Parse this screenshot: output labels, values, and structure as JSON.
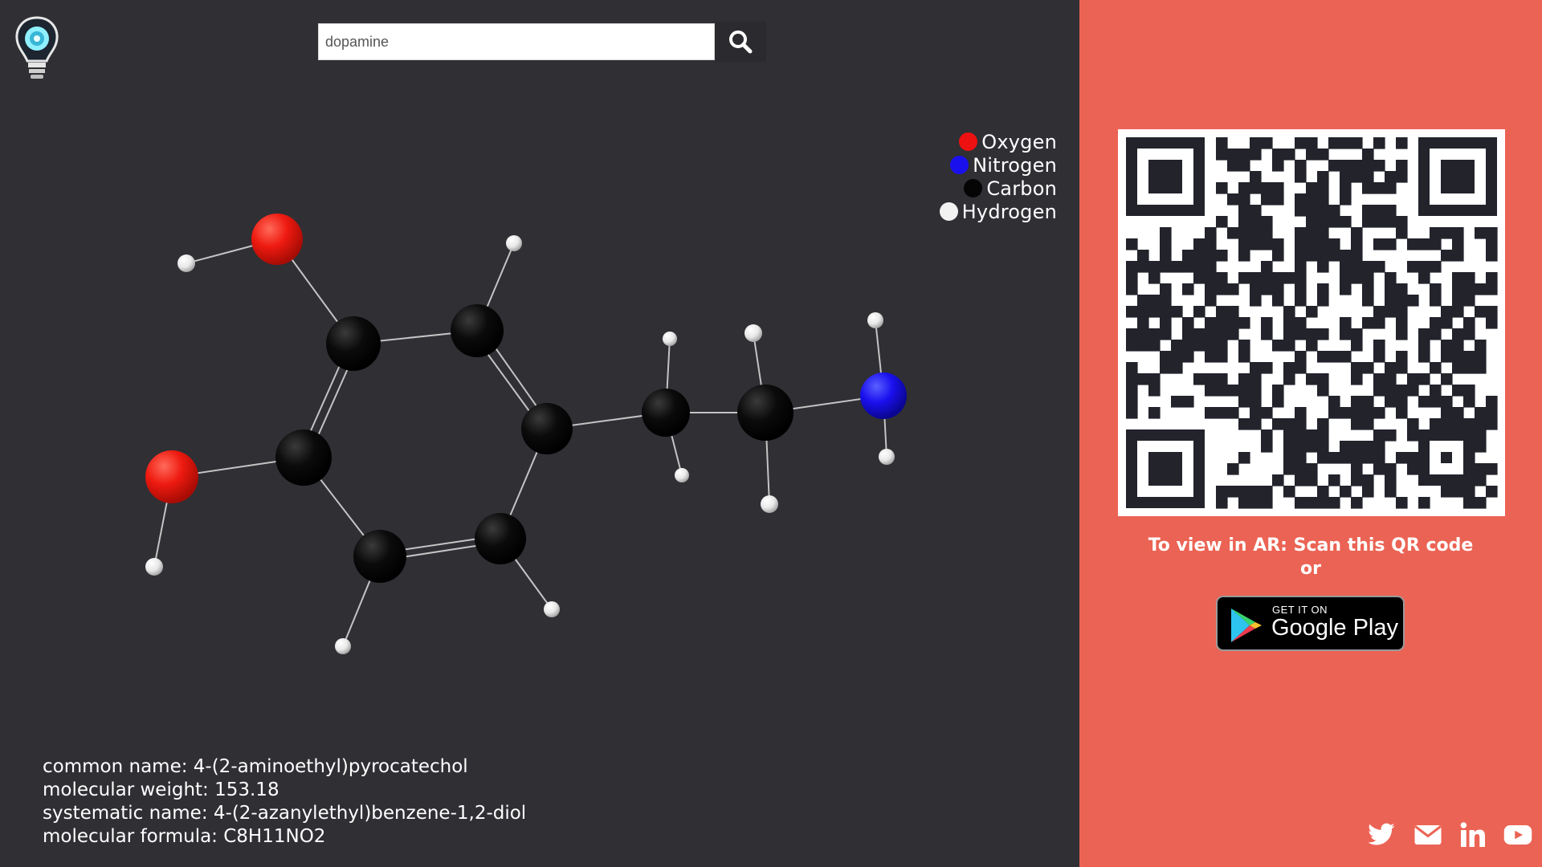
{
  "search": {
    "value": "dopamine",
    "placeholder": "dopamine"
  },
  "legend": [
    {
      "label": "Oxygen",
      "color": "#ee1111"
    },
    {
      "label": "Nitrogen",
      "color": "#1a10ee"
    },
    {
      "label": "Carbon",
      "color": "#050505"
    },
    {
      "label": "Hydrogen",
      "color": "#f2f2f2"
    }
  ],
  "info": {
    "common_name": "common name: 4-(2-aminoethyl)pyrocatechol",
    "molecular_weight": "molecular weight: 153.18",
    "systematic_name": "systematic name: 4-(2-azanylethyl)benzene-1,2-diol",
    "molecular_formula": "molecular formula: C8H11NO2"
  },
  "ar": {
    "line1": "To view in AR: Scan this QR code",
    "line2": "or"
  },
  "google_play": {
    "top": "GET IT ON",
    "main": "Google Play"
  },
  "icons": [
    "lightbulb-logo-icon",
    "search-icon",
    "twitter-icon",
    "email-icon",
    "linkedin-icon",
    "youtube-icon"
  ],
  "colors": {
    "viewer_bg": "#2f2f34",
    "side_bg": "#eb6354"
  }
}
